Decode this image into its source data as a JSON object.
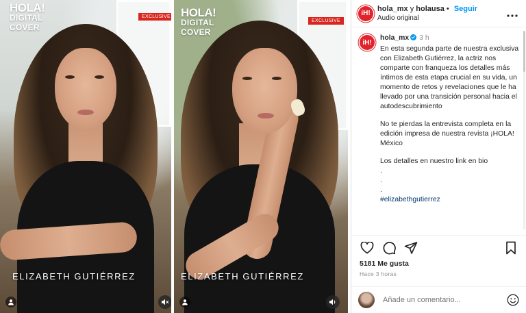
{
  "media": {
    "frames": [
      {
        "logo_line1": "HOLA!",
        "logo_line2": "DIGITAL",
        "logo_line3": "COVER",
        "badge": "EXCLUSIVE",
        "name_caption": "ELIZABETH GUTIÉRREZ",
        "user_tag_icon": "person-icon",
        "mute_icon": "muted-speaker-icon"
      },
      {
        "logo_line1": "HOLA!",
        "logo_line2": "DIGITAL",
        "logo_line3": "COVER",
        "badge": "EXCLUSIVE",
        "name_caption": "ELIZABETH GUTIÉRREZ",
        "user_tag_icon": "person-icon",
        "mute_icon": "speaker-icon"
      }
    ]
  },
  "header": {
    "avatar_text": "iH!",
    "account": "hola_mx",
    "joiner": "y",
    "collab": "holausa",
    "separator": "•",
    "follow_label": "Seguir",
    "audio": "Audio original",
    "more_icon": "more-horizontal-icon"
  },
  "caption": {
    "avatar_text": "iH!",
    "user": "hola_mx",
    "time": "3 h",
    "paragraphs": [
      "En esta segunda parte de nuestra exclusiva con Elizabeth Gutiérrez, la actriz nos comparte con franqueza los detalles más íntimos de esta etapa crucial en su vida, un momento de retos y revelaciones que le ha llevado por una transición personal hacia el autodescubrimiento",
      "No te pierdas la entrevista completa en la edición impresa de nuestra revista ¡HOLA! México",
      "Los detalles en nuestro link en bio"
    ],
    "dots": [
      ".",
      ".",
      "."
    ],
    "hashtag": "#elizabethgutierrez"
  },
  "actions": {
    "like_icon": "heart-icon",
    "comment_icon": "comment-icon",
    "share_icon": "send-icon",
    "save_icon": "bookmark-icon"
  },
  "likes": "5181 Me gusta",
  "time_ago": "Hace 3 horas",
  "comment_box": {
    "placeholder": "Añade un comentario...",
    "emoji_icon": "smile-icon"
  },
  "colors": {
    "brand_red": "#e1232b",
    "follow_blue": "#0095f6",
    "badge_red": "#d8261f"
  }
}
